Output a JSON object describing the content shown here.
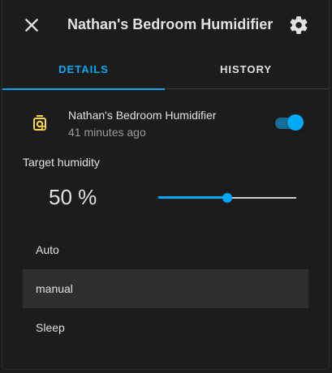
{
  "header": {
    "title": "Nathan's Bedroom Humidifier",
    "close_icon": "close-icon",
    "settings_icon": "gear-icon"
  },
  "tabs": [
    {
      "label": "DETAILS",
      "active": true
    },
    {
      "label": "HISTORY",
      "active": false
    }
  ],
  "entity": {
    "icon": "humidifier-icon",
    "name": "Nathan's Bedroom Humidifier",
    "last_changed": "41 minutes ago",
    "is_on": true
  },
  "target": {
    "label": "Target humidity",
    "value_text": "50 %",
    "value": 50,
    "min": 0,
    "max": 100
  },
  "modes": [
    {
      "label": "Auto",
      "selected": false
    },
    {
      "label": "manual",
      "selected": true
    },
    {
      "label": "Sleep",
      "selected": false
    }
  ],
  "colors": {
    "accent": "#03a9f4",
    "icon_on": "#fdd835",
    "background": "#1c1c1c",
    "selected_row": "#2e2e2e"
  }
}
